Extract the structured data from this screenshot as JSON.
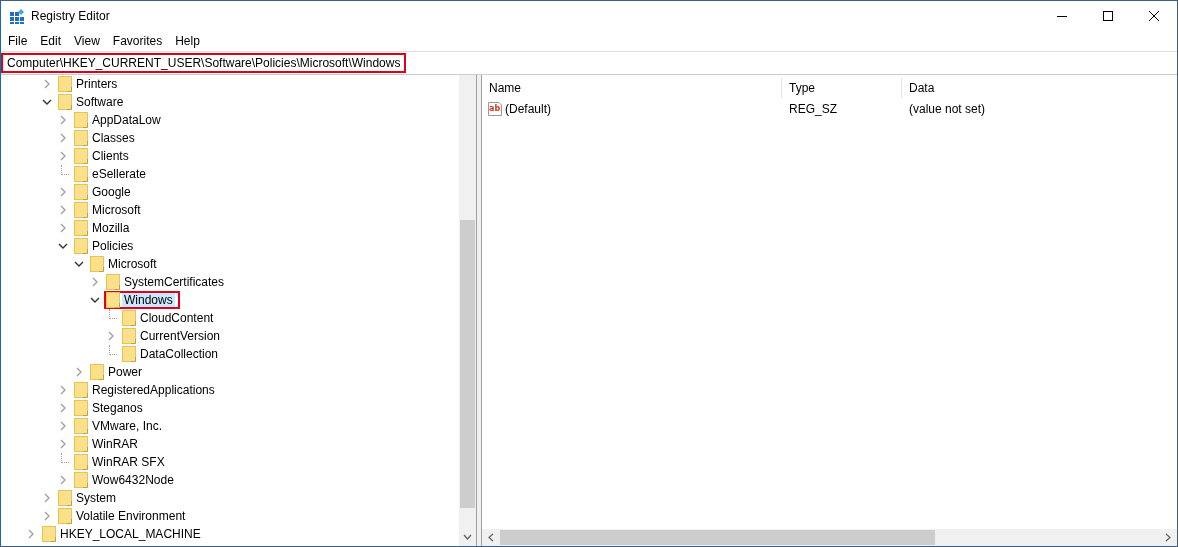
{
  "window": {
    "title": "Registry Editor"
  },
  "menu": [
    "File",
    "Edit",
    "View",
    "Favorites",
    "Help"
  ],
  "address": {
    "value": "Computer\\HKEY_CURRENT_USER\\Software\\Policies\\Microsoft\\Windows",
    "highlighted": true
  },
  "tree": {
    "continued_items": [
      {
        "label": "Printers",
        "expanded": false,
        "selected": false
      },
      {
        "label": "Software",
        "expanded": true,
        "selected": false,
        "children": [
          {
            "label": "AppDataLow",
            "expanded": false,
            "selected": false
          },
          {
            "label": "Classes",
            "expanded": false,
            "selected": false
          },
          {
            "label": "Clients",
            "expanded": false,
            "selected": false
          },
          {
            "label": "eSellerate",
            "selected": false
          },
          {
            "label": "Google",
            "expanded": false,
            "selected": false
          },
          {
            "label": "Microsoft",
            "expanded": false,
            "selected": false
          },
          {
            "label": "Mozilla",
            "expanded": false,
            "selected": false
          },
          {
            "label": "Policies",
            "expanded": true,
            "selected": false,
            "children": [
              {
                "label": "Microsoft",
                "expanded": true,
                "selected": false,
                "children": [
                  {
                    "label": "SystemCertificates",
                    "expanded": false,
                    "selected": false
                  },
                  {
                    "label": "Windows",
                    "expanded": true,
                    "selected": true,
                    "highlighted": true,
                    "children": [
                      {
                        "label": "CloudContent",
                        "selected": false
                      },
                      {
                        "label": "CurrentVersion",
                        "expanded": false,
                        "selected": false
                      },
                      {
                        "label": "DataCollection",
                        "selected": false
                      }
                    ]
                  }
                ]
              },
              {
                "label": "Power",
                "expanded": false,
                "selected": false
              }
            ]
          },
          {
            "label": "RegisteredApplications",
            "expanded": false,
            "selected": false
          },
          {
            "label": "Steganos",
            "expanded": false,
            "selected": false
          },
          {
            "label": "VMware, Inc.",
            "expanded": false,
            "selected": false
          },
          {
            "label": "WinRAR",
            "expanded": false,
            "selected": false
          },
          {
            "label": "WinRAR SFX",
            "selected": false
          },
          {
            "label": "Wow6432Node",
            "expanded": false,
            "selected": false
          }
        ]
      },
      {
        "label": "System",
        "expanded": false,
        "selected": false
      },
      {
        "label": "Volatile Environment",
        "expanded": false,
        "selected": false
      }
    ],
    "root_items": [
      {
        "label": "HKEY_LOCAL_MACHINE",
        "expanded": false,
        "selected": false
      }
    ]
  },
  "values": {
    "columns": [
      "Name",
      "Type",
      "Data"
    ],
    "rows": [
      {
        "icon_text": "ab",
        "name": "(Default)",
        "type": "REG_SZ",
        "data": "(value not set)"
      }
    ]
  }
}
